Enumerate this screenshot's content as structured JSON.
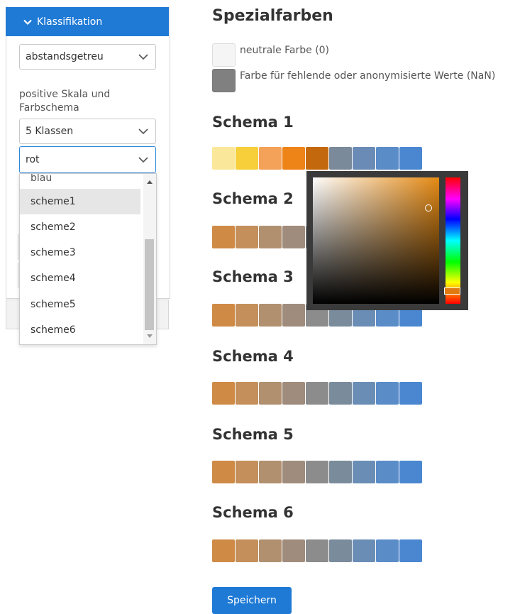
{
  "sidebar": {
    "header_label": "Klassifikation",
    "mode_select": "abstandsgetreu",
    "scale_label": "positive Skala und Farbschema",
    "classes_select": "5 Klassen",
    "color_select": "rot",
    "dropdown_options": [
      "blau",
      "scheme1",
      "scheme2",
      "scheme3",
      "scheme4",
      "scheme5",
      "scheme6"
    ],
    "hovered_option": "scheme1"
  },
  "main": {
    "title": "Spezialfarben",
    "special": [
      {
        "label": "neutrale Farbe (0)",
        "color": "#f5f5f5"
      },
      {
        "label": "Farbe für fehlende oder anonymisierte Werte (NaN)",
        "color": "#808080"
      }
    ],
    "schemes": [
      {
        "title": "Schema 1",
        "colors": [
          "#fbe79a",
          "#f6cf3a",
          "#f4a25a",
          "#ee8417",
          "#c4680e",
          "#7a8a9a",
          "#6a8bb6",
          "#5a8cc8",
          "#4a87d0"
        ]
      },
      {
        "title": "Schema 2",
        "colors": [
          "#cf8a45",
          "#c48f5a",
          "#b0906f",
          "#a08c7c",
          "#8c8c8c",
          "#7a8c9c",
          "#6a8db6",
          "#5a8dc8",
          "#4a87d0"
        ]
      },
      {
        "title": "Schema 3",
        "colors": [
          "#cf8a45",
          "#c48f5a",
          "#b0906f",
          "#a08c7c",
          "#8c8c8c",
          "#7a8c9c",
          "#6a8db6",
          "#5a8dc8",
          "#4a87d0"
        ]
      },
      {
        "title": "Schema 4",
        "colors": [
          "#cf8a45",
          "#c48f5a",
          "#b0906f",
          "#a08c7c",
          "#8c8c8c",
          "#7a8c9c",
          "#6a8db6",
          "#5a8dc8",
          "#4a87d0"
        ]
      },
      {
        "title": "Schema 5",
        "colors": [
          "#cf8a45",
          "#c48f5a",
          "#b0906f",
          "#a08c7c",
          "#8c8c8c",
          "#7a8c9c",
          "#6a8db6",
          "#5a8dc8",
          "#4a87d0"
        ]
      },
      {
        "title": "Schema 6",
        "colors": [
          "#cf8a45",
          "#c48f5a",
          "#b0906f",
          "#a08c7c",
          "#8c8c8c",
          "#7a8c9c",
          "#6a8db6",
          "#5a8dc8",
          "#4a87d0"
        ]
      }
    ],
    "save_label": "Speichern"
  },
  "colors": {
    "accent": "#1f7ad6",
    "picker_hue": "#e58a14"
  }
}
